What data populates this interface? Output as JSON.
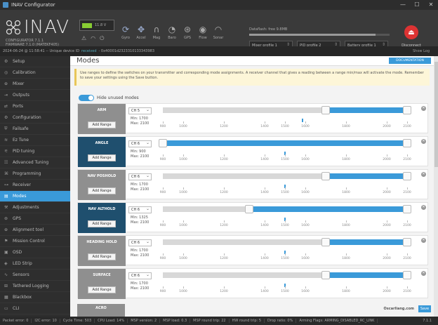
{
  "window": {
    "title": "INAV Configurator",
    "controls": [
      "—",
      "☐",
      "✕"
    ]
  },
  "header": {
    "logo": "INAV",
    "fw_lines": [
      "CONFIGURATOR  7.1.1",
      "FIRMWARE       7.1.0 (MATEKF405)"
    ],
    "battery_voltage": "11.8 V",
    "sensors": [
      {
        "label": "Gyro",
        "icon": "gyro-icon",
        "glyph": "⟳",
        "active": true
      },
      {
        "label": "Accel",
        "icon": "accel-icon",
        "glyph": "✥",
        "active": true
      },
      {
        "label": "Mag",
        "icon": "mag-icon",
        "glyph": "∩",
        "active": false
      },
      {
        "label": "Baro",
        "icon": "baro-icon",
        "glyph": "◔",
        "active": false
      },
      {
        "label": "GPS",
        "icon": "gps-icon",
        "glyph": "⊛",
        "active": false
      },
      {
        "label": "Flow",
        "icon": "flow-icon",
        "glyph": "◉",
        "active": false
      },
      {
        "label": "Sonar",
        "icon": "sonar-icon",
        "glyph": "◠",
        "active": false
      }
    ],
    "dataflash_label": "Dataflash: free 9.8MB",
    "profiles": [
      "Mixer profile 1",
      "PID profile 2",
      "Battery profile 1"
    ],
    "disconnect_label": "Disconnect"
  },
  "infobar": {
    "timestamp": "2024-06-24 @ 11:58:41 -- Unique device ID",
    "link": "received",
    "device_id": "- 0x40001d2323310133343983",
    "show_log": "Show Log"
  },
  "sidebar": {
    "items": [
      {
        "label": "Setup",
        "icon": "⚙"
      },
      {
        "label": "Calibration",
        "icon": "◎"
      },
      {
        "label": "Mixer",
        "icon": "⊕"
      },
      {
        "label": "Outputs",
        "icon": "⇥"
      },
      {
        "label": "Ports",
        "icon": "⇄"
      },
      {
        "label": "Configuration",
        "icon": "⚙"
      },
      {
        "label": "Failsafe",
        "icon": "⛨"
      },
      {
        "label": "Ez Tune",
        "icon": "≋"
      },
      {
        "label": "PID tuning",
        "icon": "⚟"
      },
      {
        "label": "Advanced Tuning",
        "icon": "☷"
      },
      {
        "label": "Programming",
        "icon": "⌘"
      },
      {
        "label": "Receiver",
        "icon": "⊶"
      },
      {
        "label": "Modes",
        "icon": "▤",
        "active": true
      },
      {
        "label": "Adjustments",
        "icon": "⚒"
      },
      {
        "label": "GPS",
        "icon": "⊛"
      },
      {
        "label": "Alignment tool",
        "icon": "⊕"
      },
      {
        "label": "Mission Control",
        "icon": "⚑"
      },
      {
        "label": "OSD",
        "icon": "▣"
      },
      {
        "label": "LED Strip",
        "icon": "◈"
      },
      {
        "label": "Sensors",
        "icon": "∿"
      },
      {
        "label": "Tethered Logging",
        "icon": "⊞"
      },
      {
        "label": "Blackbox",
        "icon": "▦"
      },
      {
        "label": "CLI",
        "icon": "▭"
      }
    ]
  },
  "content": {
    "title": "Modes",
    "doc_button": "DOCUMENTATION",
    "note": "Use ranges to define the switches on your transmitter and corresponding mode assignments. A receiver channel that gives a reading between a range min/max will activate the mode. Remember to save your settings using the Save button.",
    "toggle_label": "Hide unused modes",
    "add_range_label": "Add Range",
    "ticks": [
      "900",
      "1000",
      "1200",
      "1400",
      "1500",
      "1600",
      "1800",
      "2000",
      "2100"
    ],
    "modes": [
      {
        "name": "ARM",
        "channel": "CH 5",
        "min": "Min: 1700",
        "max": "Max: 2100",
        "range_min": 1700,
        "range_max": 2100,
        "current": 1585,
        "active": false
      },
      {
        "name": "ANGLE",
        "channel": "CH 6",
        "min": "Min: 900",
        "max": "Max: 2100",
        "range_min": 900,
        "range_max": 2100,
        "current": 1500,
        "active": true
      },
      {
        "name": "NAV POSHOLD",
        "channel": "CH 6",
        "min": "Min: 1700",
        "max": "Max: 2100",
        "range_min": 1700,
        "range_max": 2100,
        "current": 1500,
        "active": false
      },
      {
        "name": "NAV ALTHOLD",
        "channel": "CH 6",
        "min": "Min: 1325",
        "max": "Max: 2100",
        "range_min": 1325,
        "range_max": 2100,
        "current": 1500,
        "active": true
      },
      {
        "name": "HEADING HOLD",
        "channel": "CH 6",
        "min": "Min: 1700",
        "max": "Max: 2100",
        "range_min": 1700,
        "range_max": 2100,
        "current": 1500,
        "active": false
      },
      {
        "name": "SURFACE",
        "channel": "CH 6",
        "min": "Min: 1700",
        "max": "Max: 2100",
        "range_min": 1700,
        "range_max": 2100,
        "current": 1500,
        "active": false
      }
    ],
    "next_mode": "ACRO",
    "save_label": "Save",
    "watermark": "Oscarliang.com"
  },
  "statusbar": {
    "items": [
      "Packet error: 0",
      "I2C error: 10",
      "Cycle Time: 503",
      "CPU Load: 14%",
      "MSP version: 2",
      "MSP load: 0.3",
      "MSP round trip: 22",
      "HW round trip: 5",
      "Drop ratio: 0%",
      "Arming Flags: ARMING_DISABLED_RC_LINK"
    ],
    "version": "7.1.1"
  }
}
